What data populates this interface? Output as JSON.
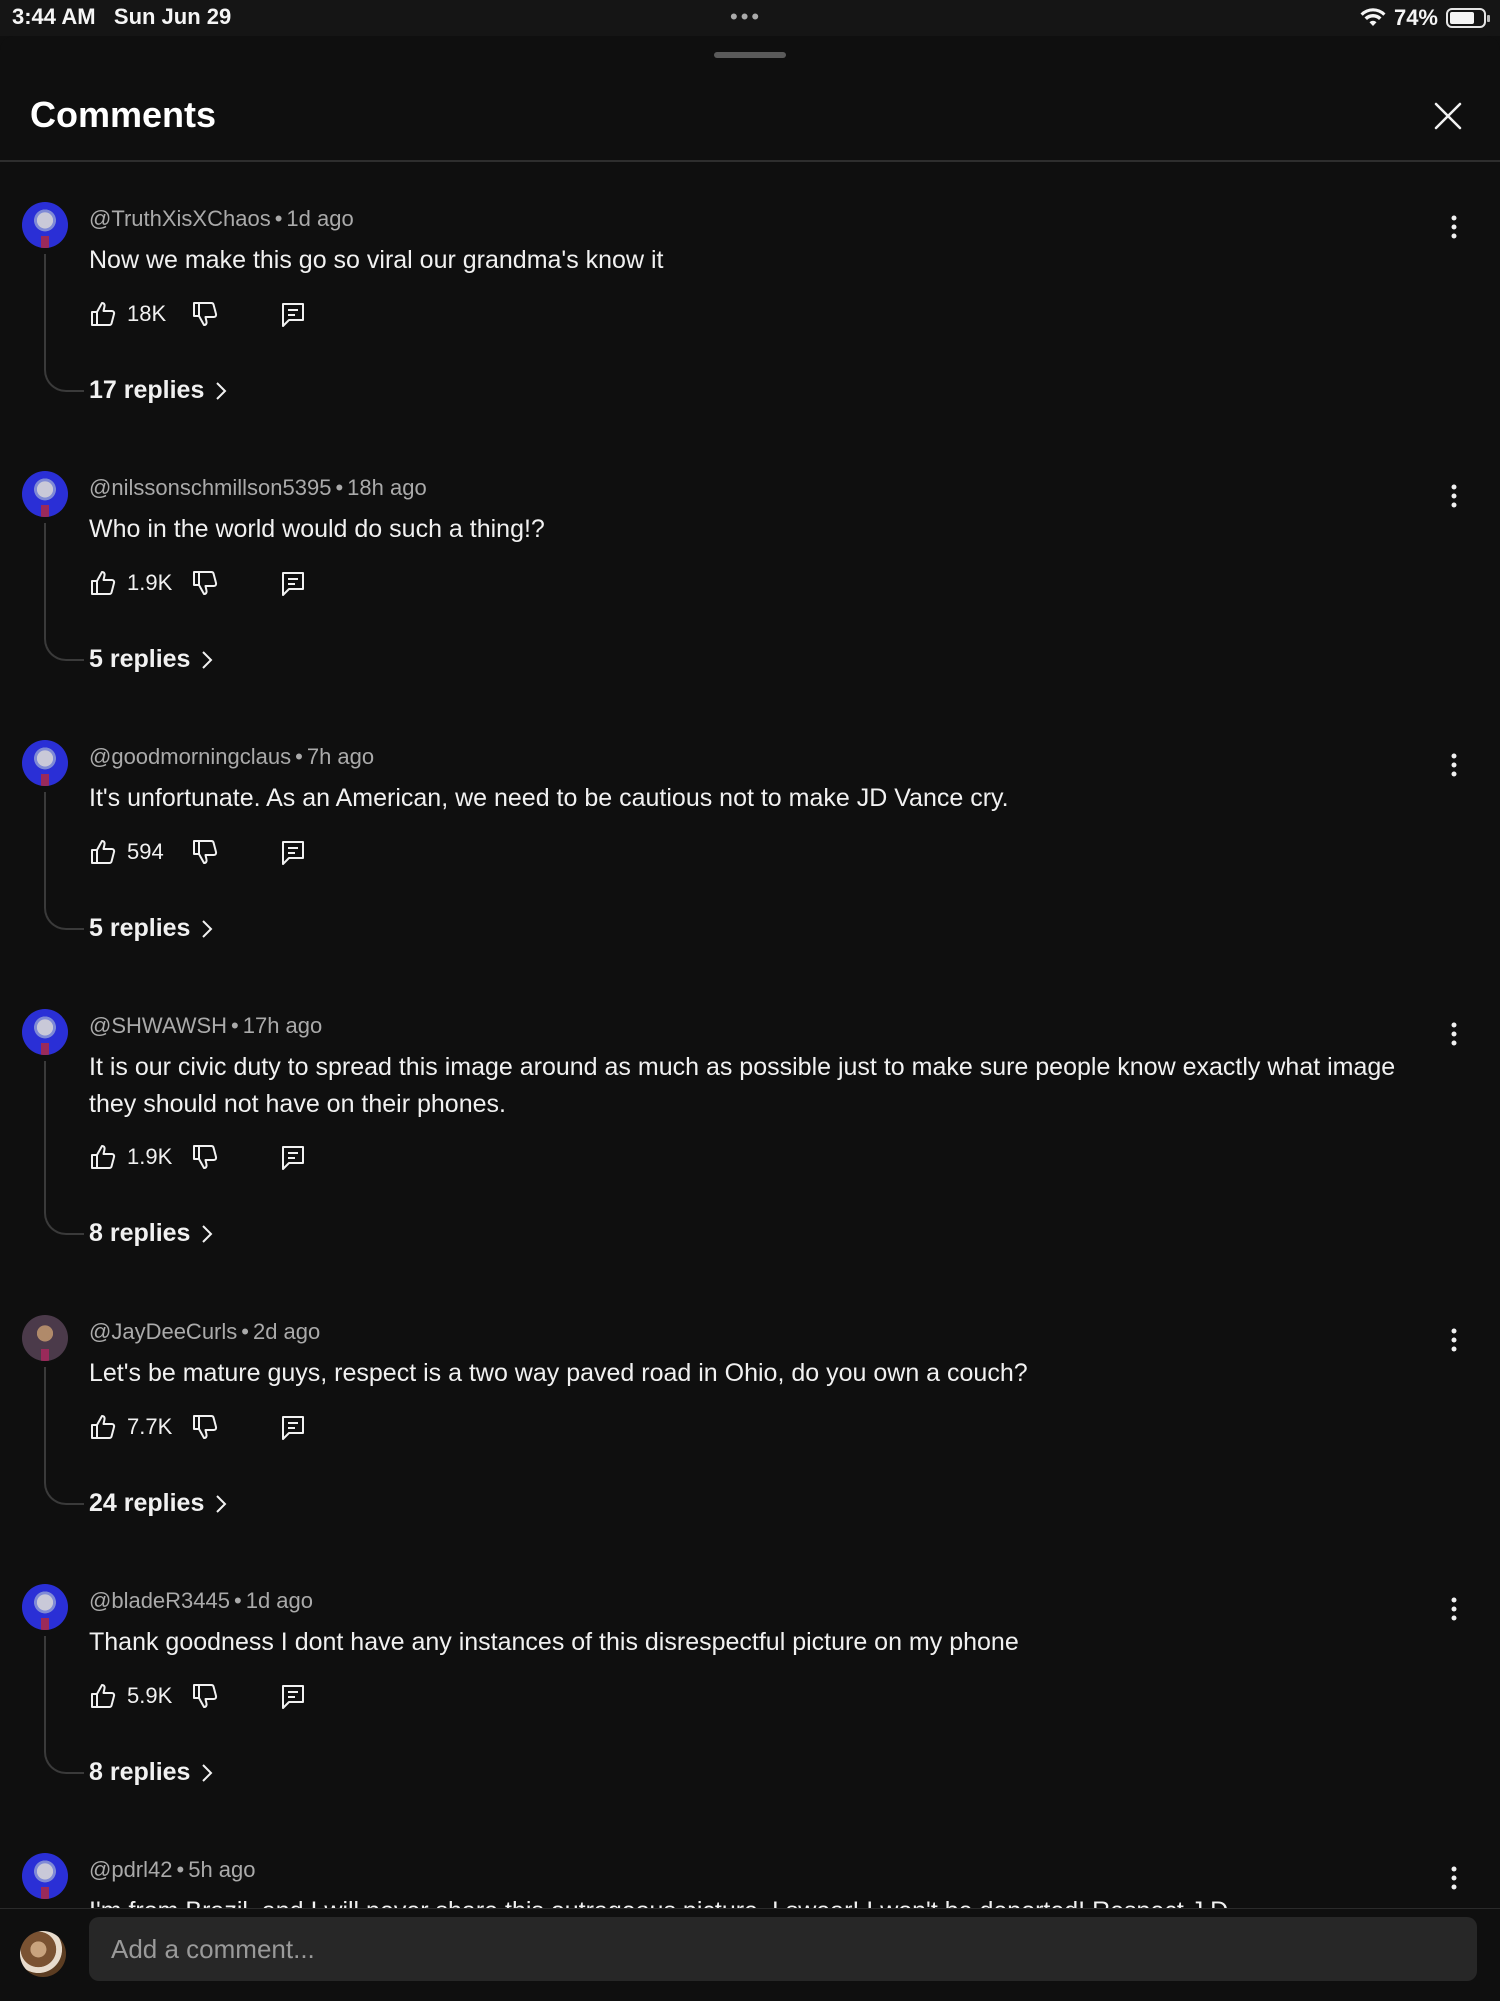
{
  "status_bar": {
    "time": "3:44 AM",
    "date": "Sun Jun 29",
    "battery": "74%",
    "battery_level": 0.74,
    "icons": [
      "wifi-icon",
      "battery-icon"
    ]
  },
  "header": {
    "title": "Comments",
    "close_icon": "close-icon"
  },
  "comments": [
    {
      "author": "@TruthXisXChaos",
      "time": "1d ago",
      "text": "Now we make this go so viral our grandma's know it",
      "likes": "18K",
      "replies": "17 replies"
    },
    {
      "author": "@nilssonschmillson5395",
      "time": "18h ago",
      "text": "Who in the world would do such a thing!?",
      "likes": "1.9K",
      "replies": "5 replies"
    },
    {
      "author": "@goodmorningclaus",
      "time": "7h ago",
      "text": "It's unfortunate. As an American, we need to be cautious not to make JD Vance cry.",
      "likes": "594",
      "replies": "5 replies"
    },
    {
      "author": "@SHWAWSH",
      "time": "17h ago",
      "text": "It is our civic duty to spread this image around as much as possible just to make sure people know exactly what image they should not have on their phones.",
      "likes": "1.9K",
      "replies": "8 replies"
    },
    {
      "author": "@JayDeeCurls",
      "time": "2d ago",
      "text": "Let's be mature guys, respect is a two way paved road in Ohio, do you own a couch?",
      "likes": "7.7K",
      "replies": "24 replies"
    },
    {
      "author": "@bladeR3445",
      "time": "1d ago",
      "text": "Thank goodness I dont have any instances of this disrespectful picture on my phone",
      "likes": "5.9K",
      "replies": "8 replies"
    },
    {
      "author": "@pdrl42",
      "time": "5h ago",
      "text": "I'm from Brazil, and I will never share this outrageous picture. I swear! I won't be deported! Respect J.D"
    }
  ],
  "composer": {
    "placeholder": "Add a comment..."
  },
  "colors": {
    "background": "#0f0f0f",
    "text": "#f1f1f1",
    "secondary_text": "#aaaaaa",
    "input_bg": "#272727"
  }
}
